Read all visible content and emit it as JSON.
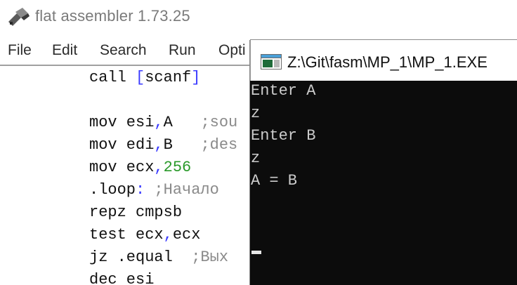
{
  "editor": {
    "title": "flat assembler 1.73.25",
    "menu": [
      "File",
      "Edit",
      "Search",
      "Run",
      "Opti"
    ],
    "code_lines": [
      [
        {
          "t": "call ",
          "c": "kw"
        },
        {
          "t": "[",
          "c": "sym"
        },
        {
          "t": "scanf",
          "c": "kw"
        },
        {
          "t": "]",
          "c": "sym"
        }
      ],
      [],
      [
        {
          "t": "mov esi",
          "c": "kw"
        },
        {
          "t": ",",
          "c": "sym"
        },
        {
          "t": "A   ",
          "c": "kw"
        },
        {
          "t": ";sou",
          "c": "cmt"
        }
      ],
      [
        {
          "t": "mov edi",
          "c": "kw"
        },
        {
          "t": ",",
          "c": "sym"
        },
        {
          "t": "B   ",
          "c": "kw"
        },
        {
          "t": ";des",
          "c": "cmt"
        }
      ],
      [
        {
          "t": "mov ecx",
          "c": "kw"
        },
        {
          "t": ",",
          "c": "sym"
        },
        {
          "t": "256",
          "c": "num"
        }
      ],
      [
        {
          "t": ".loop",
          "c": "kw"
        },
        {
          "t": ":",
          "c": "sym"
        },
        {
          "t": " ;Начало",
          "c": "cmt"
        }
      ],
      [
        {
          "t": "repz cmpsb",
          "c": "kw"
        }
      ],
      [
        {
          "t": "test ecx",
          "c": "kw"
        },
        {
          "t": ",",
          "c": "sym"
        },
        {
          "t": "ecx",
          "c": "kw"
        }
      ],
      [
        {
          "t": "jz .equal  ",
          "c": "kw"
        },
        {
          "t": ";Вых",
          "c": "cmt"
        }
      ],
      [
        {
          "t": "dec esi",
          "c": "kw"
        }
      ]
    ]
  },
  "console": {
    "title": "Z:\\Git\\fasm\\MP_1\\MP_1.EXE",
    "lines": [
      "Enter A",
      "z",
      "Enter B",
      "z",
      "A = B"
    ]
  },
  "colors": {
    "console_bg": "#0c0c0c",
    "console_text": "#cccccc",
    "code_symbol": "#3a3aff",
    "code_number": "#2a9a2a",
    "code_comment": "#8a8a8a"
  },
  "icons": {
    "editor": "fasm-app-icon",
    "console": "console-app-icon"
  }
}
